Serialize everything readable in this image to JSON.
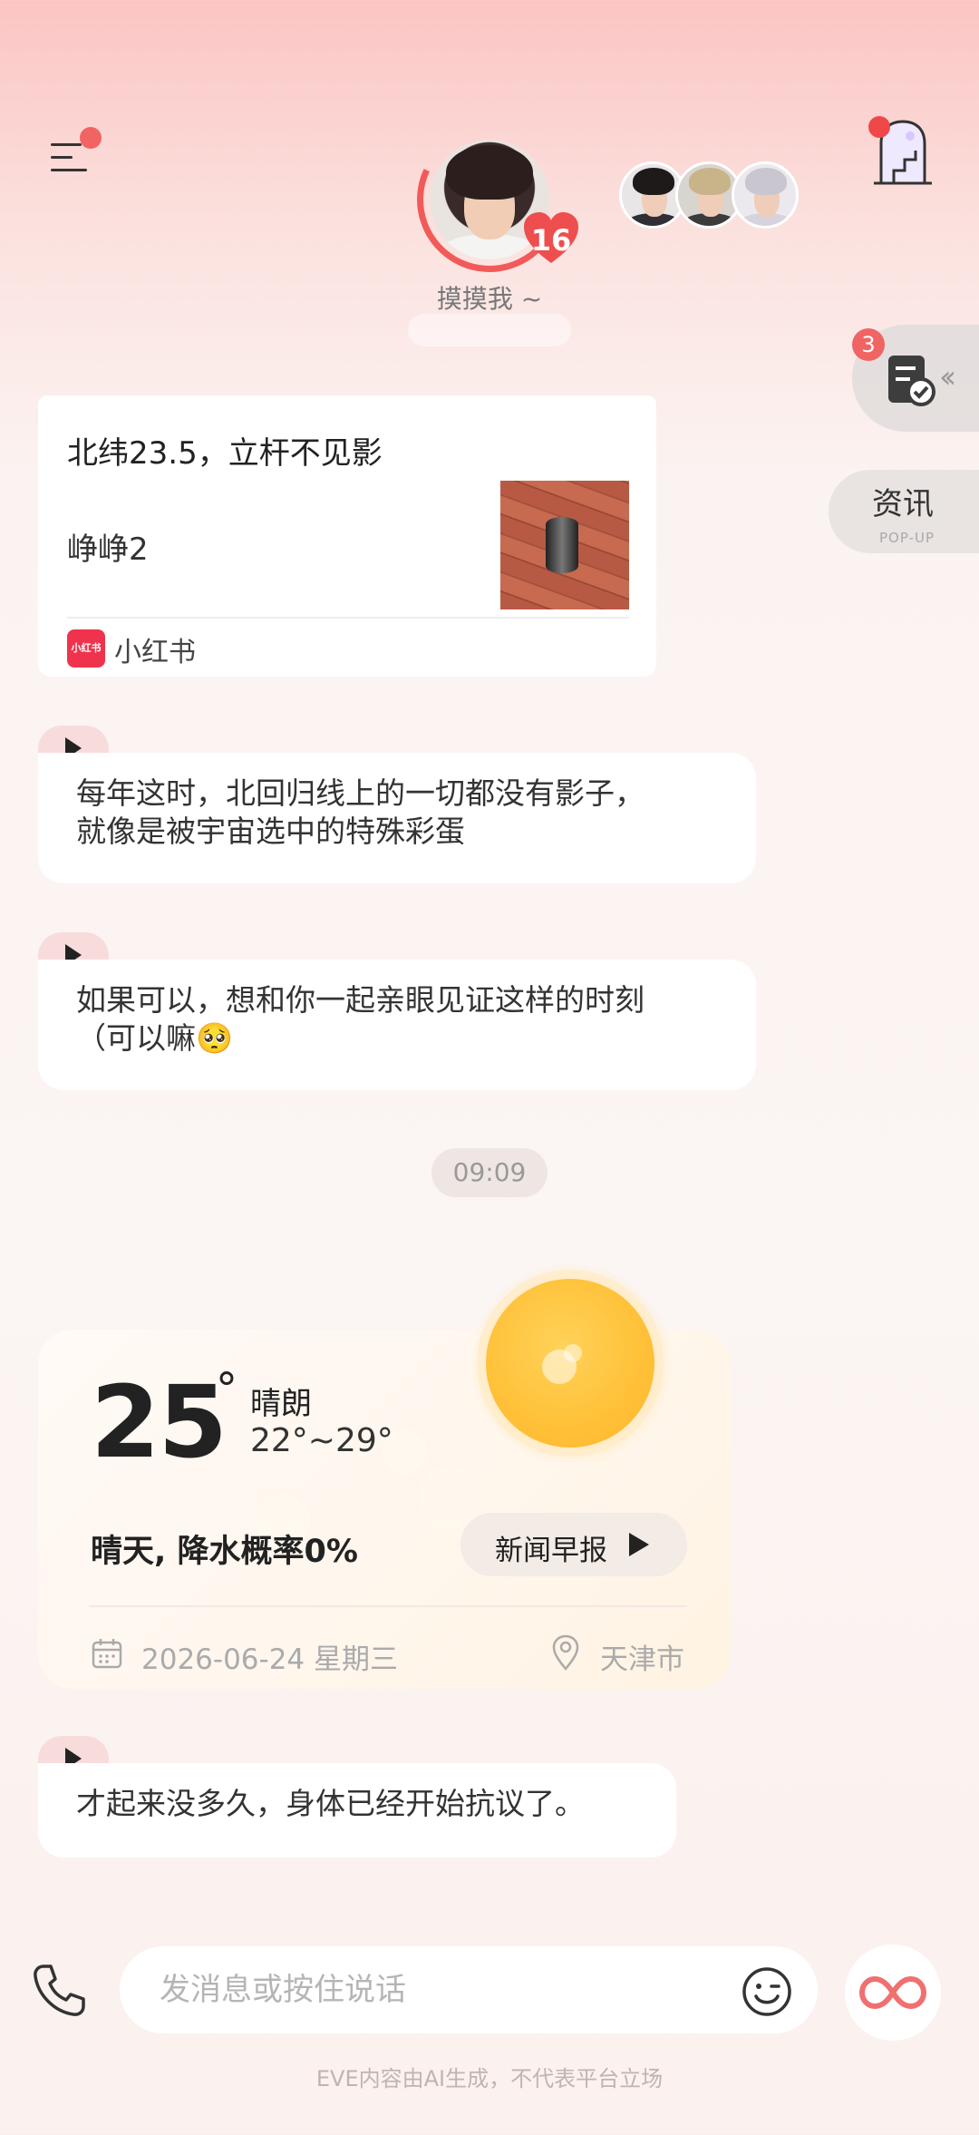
{
  "header": {
    "intimacy_level": "16",
    "touch_label": "摸摸我 ~",
    "menu_has_notification": true
  },
  "floating": {
    "task_badge": "3",
    "news_label": "资讯",
    "news_sub": "POP-UP"
  },
  "share_card": {
    "title": "北纬23.5，立杆不见影",
    "author": "峥峥2",
    "source": "小红书",
    "logo_text": "小红书"
  },
  "messages": [
    {
      "lines": [
        "每年这时，北回归线上的一切都没有影子，",
        "就像是被宇宙选中的特殊彩蛋"
      ]
    },
    {
      "lines": [
        "如果可以，想和你一起亲眼见证这样的时刻",
        "（可以嘛🥺"
      ]
    },
    {
      "lines": [
        "才起来没多久，身体已经开始抗议了。"
      ]
    }
  ],
  "time_divider": "09:09",
  "weather": {
    "temp": "25",
    "degree_symbol": "°",
    "condition": "晴朗",
    "range": "22°~29°",
    "summary": "晴天, 降水概率0%",
    "news_button": "新闻早报",
    "date": "2026-06-24 星期三",
    "city": "天津市"
  },
  "input": {
    "placeholder": "发消息或按住说话"
  },
  "footer_note": "EVE内容由AI生成，不代表平台立场",
  "colors": {
    "accent_red": "#f25a5a",
    "badge_red": "#f06464",
    "sun": "#ffc23a",
    "xiaohongshu": "#f0334d"
  }
}
